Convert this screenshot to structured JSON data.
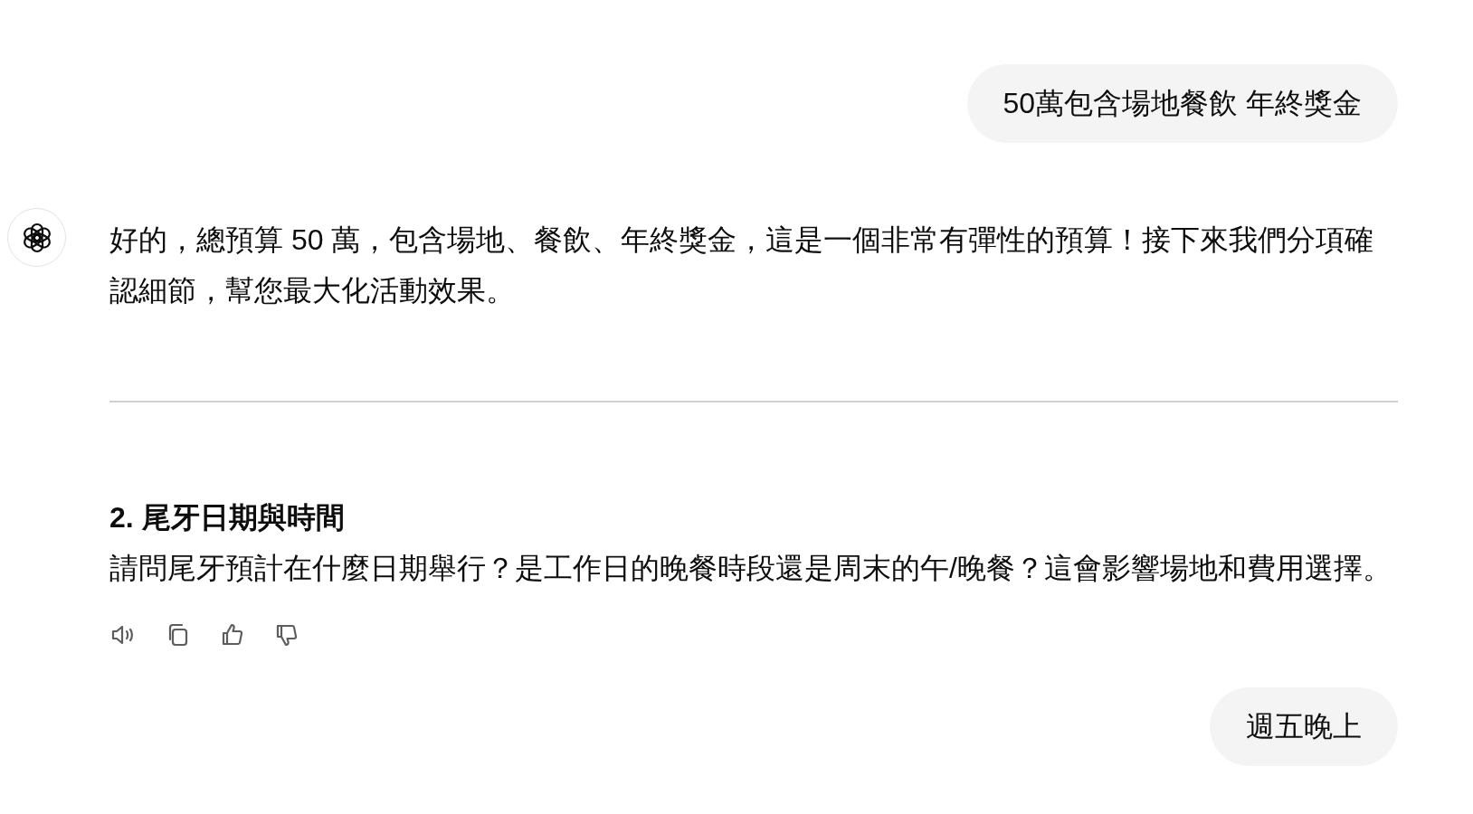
{
  "messages": [
    {
      "kind": "user",
      "text": "50萬包含場地餐飲 年終獎金"
    },
    {
      "kind": "assistant",
      "blocks": [
        {
          "kind": "paragraph",
          "text": "好的，總預算 50 萬，包含場地、餐飲、年終獎金，這是一個非常有彈性的預算！接下來我們分項確認細節，幫您最大化活動效果。"
        },
        {
          "kind": "divider"
        },
        {
          "kind": "heading",
          "text": "2. 尾牙日期與時間"
        },
        {
          "kind": "paragraph",
          "text": "請問尾牙預計在什麼日期舉行？是工作日的晚餐時段還是周末的午/晚餐？這會影響場地和費用選擇。"
        }
      ]
    },
    {
      "kind": "user",
      "text": "週五晚上"
    }
  ]
}
